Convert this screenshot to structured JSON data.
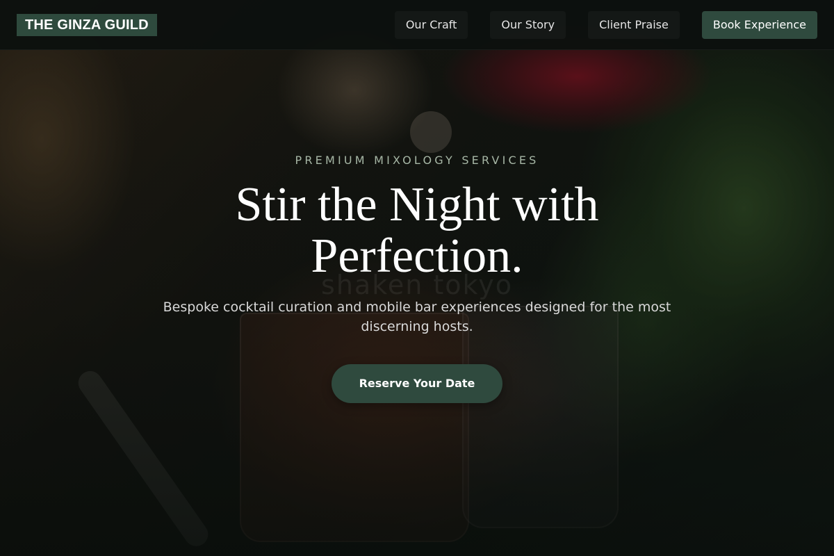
{
  "brand": {
    "logo_text": "THE GINZA GUILD"
  },
  "nav": {
    "links": [
      {
        "label": "Our Craft"
      },
      {
        "label": "Our Story"
      },
      {
        "label": "Client Praise"
      }
    ],
    "cta_label": "Book Experience"
  },
  "hero": {
    "eyebrow": "PREMIUM MIXOLOGY SERVICES",
    "headline": "Stir the Night with Perfection.",
    "subtext": "Bespoke cocktail curation and mobile bar experiences designed for the most discerning hosts.",
    "cta_label": "Reserve Your Date"
  },
  "colors": {
    "accent": "#2f4a3e",
    "eyebrow": "#a7b7a6",
    "nav_bg": "#0c100e"
  },
  "icons": []
}
